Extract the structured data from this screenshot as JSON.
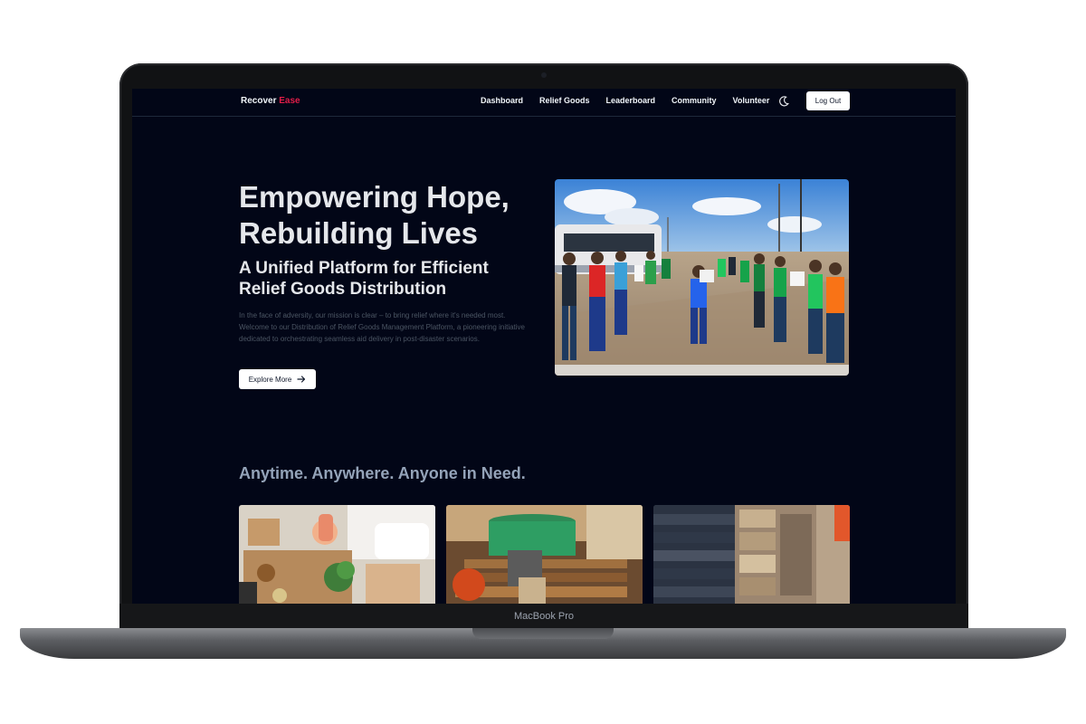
{
  "device": {
    "label": "MacBook Pro"
  },
  "navbar": {
    "brand_main": "Recover",
    "brand_accent": "Ease",
    "links": [
      "Dashboard",
      "Relief Goods",
      "Leaderboard",
      "Community",
      "Volunteer"
    ],
    "theme_toggle_icon": "moon-icon",
    "logout_label": "Log Out"
  },
  "hero": {
    "title": "Empowering Hope, Rebuilding Lives",
    "subtitle": "A Unified Platform for Efficient Relief Goods Distribution",
    "body": "In the face of adversity, our mission is clear – to bring relief where it's needed most. Welcome to our Distribution of Relief Goods Management Platform, a pioneering initiative dedicated to orchestrating seamless aid delivery in post-disaster scenarios.",
    "cta_label": "Explore More",
    "cta_icon": "arrow-right-icon"
  },
  "section": {
    "title": "Anytime. Anywhere. Anyone in Need."
  },
  "colors": {
    "screen_bg": "#020617",
    "brand_accent": "#e11d48",
    "heading": "#e5e7eb",
    "section_heading": "#94a3b8",
    "body_text": "#4b5563"
  }
}
